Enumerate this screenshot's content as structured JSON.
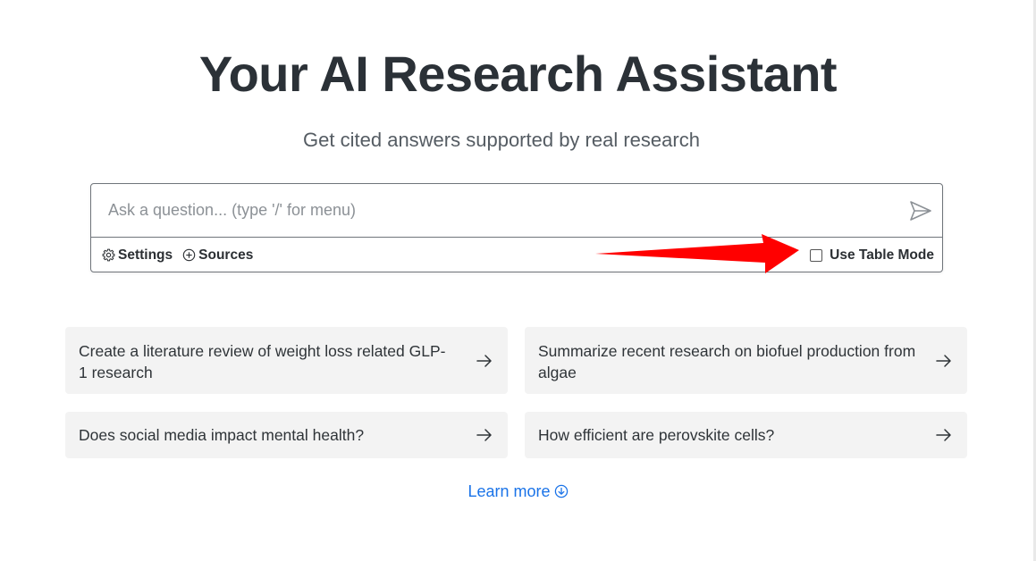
{
  "hero": {
    "title": "Your AI Research Assistant",
    "subtitle": "Get cited answers supported by real research"
  },
  "search": {
    "placeholder": "Ask a question... (type '/' for menu)",
    "value": "",
    "send_icon": "send-icon"
  },
  "toolbar": {
    "settings_label": "Settings",
    "settings_icon": "gear-icon",
    "sources_label": "Sources",
    "sources_icon": "plus-circle-icon",
    "table_mode_label": "Use Table Mode",
    "table_mode_checked": false
  },
  "annotation": {
    "arrow_color": "#ff0000"
  },
  "suggestions": [
    {
      "text": "Create a literature review of weight loss related GLP-1 research"
    },
    {
      "text": "Summarize recent research on biofuel production from algae"
    },
    {
      "text": "Does social media impact mental health?"
    },
    {
      "text": "How efficient are perovskite cells?"
    }
  ],
  "footer": {
    "learn_more_label": "Learn more",
    "learn_more_icon": "arrow-down-circle-icon",
    "link_color": "#1a73e8"
  }
}
